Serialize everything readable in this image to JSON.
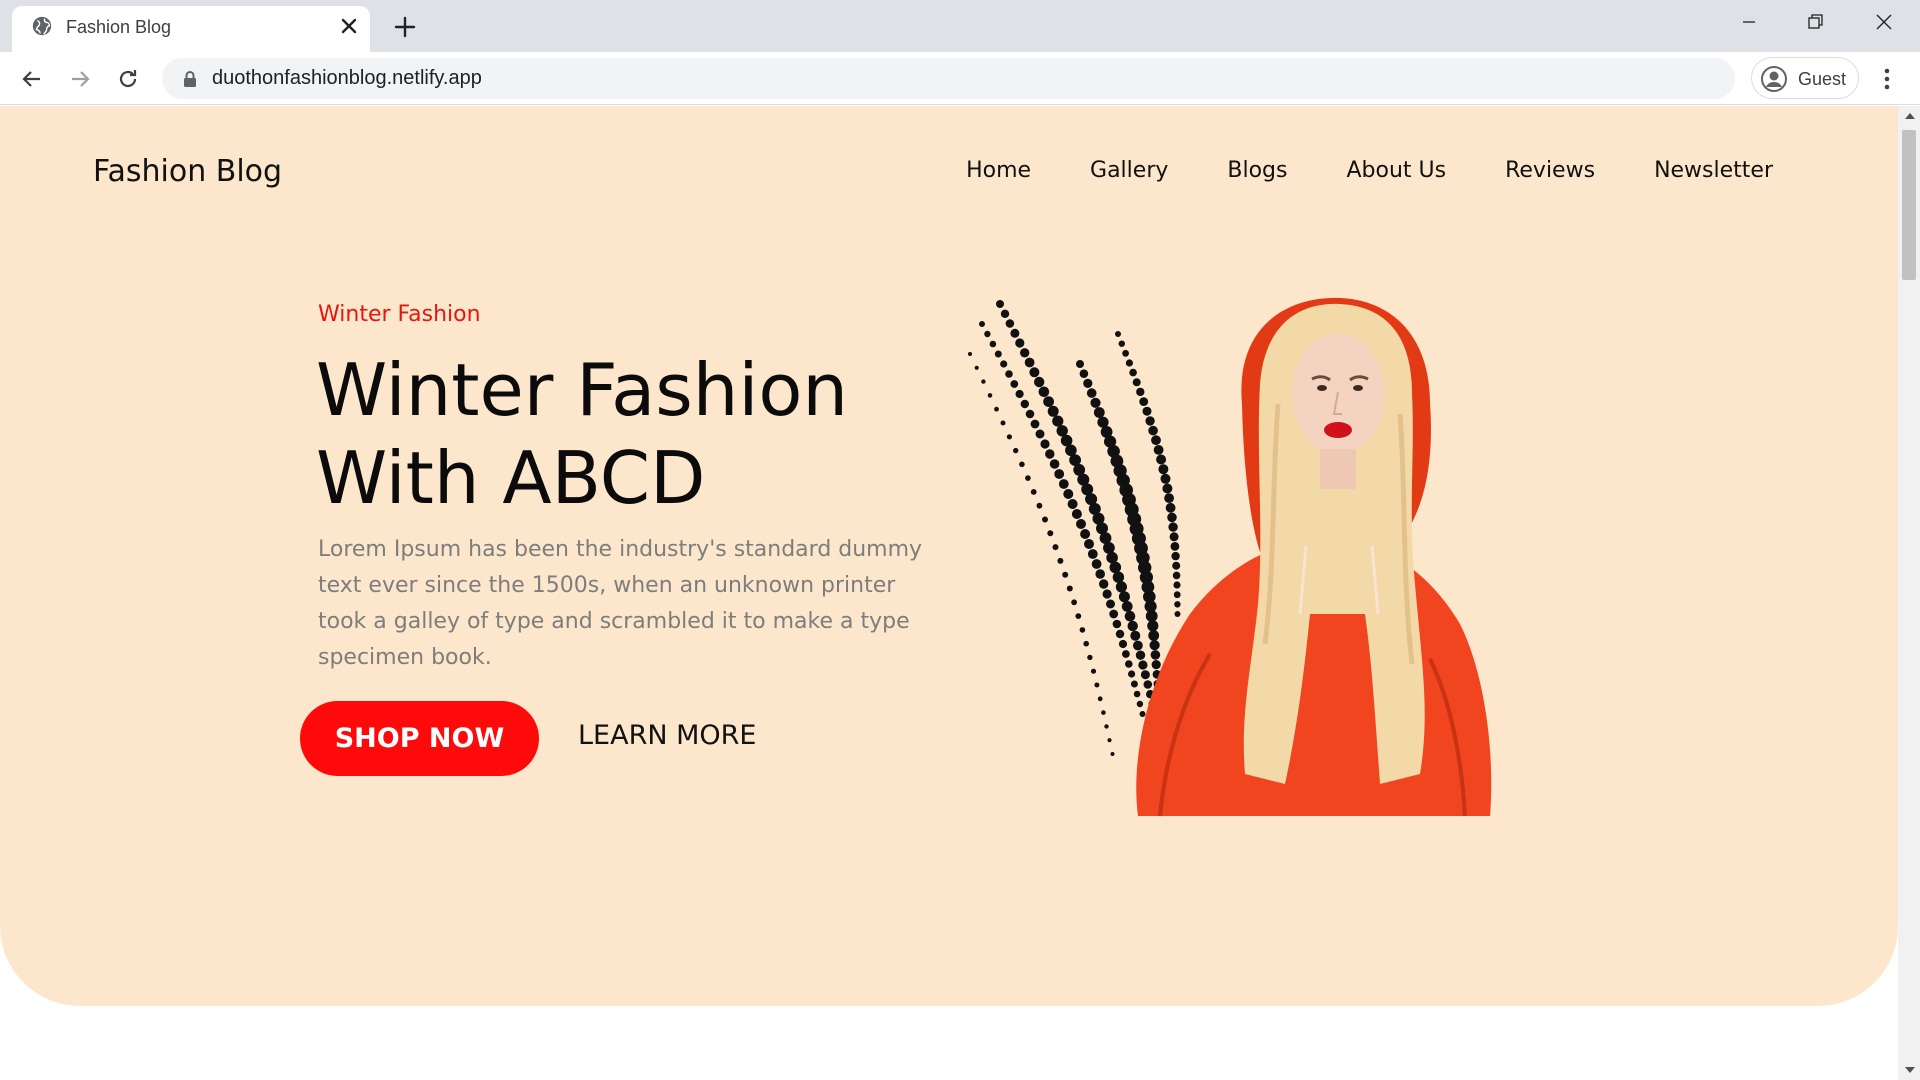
{
  "browser": {
    "tab_title": "Fashion Blog",
    "url": "duothonfashionblog.netlify.app",
    "profile_label": "Guest"
  },
  "site": {
    "brand": "Fashion Blog",
    "nav": [
      "Home",
      "Gallery",
      "Blogs",
      "About Us",
      "Reviews",
      "Newsletter"
    ]
  },
  "hero": {
    "eyebrow": "Winter Fashion",
    "headline_line1": "Winter Fashion",
    "headline_line2": "With ABCD",
    "lead": "Lorem Ipsum has been the industry's standard dummy text ever since the 1500s, when an unknown printer took a galley of type and scrambled it to make a type specimen book.",
    "shop_label": "SHOP NOW",
    "learn_label": "LEARN MORE"
  },
  "colors": {
    "hero_bg": "#fde7cc",
    "accent": "#fe0a0a",
    "eyebrow": "#e8140e",
    "hoodie": "#f0451f",
    "hair": "#f3d9a8"
  },
  "icons": {
    "favicon": "globe-icon",
    "tab_close": "close-icon",
    "new_tab": "plus-icon",
    "back": "back-arrow-icon",
    "forward": "forward-arrow-icon",
    "reload": "reload-icon",
    "lock": "lock-icon",
    "profile": "account-icon",
    "menu": "kebab-menu-icon"
  }
}
